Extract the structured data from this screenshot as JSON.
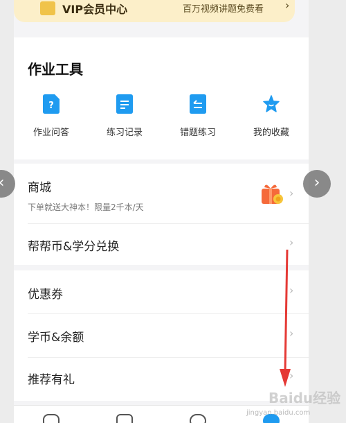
{
  "vip": {
    "title": "VIP会员中心",
    "subtitle": "百万视频讲题免费看",
    "arrow": "›"
  },
  "tools": {
    "title": "作业工具",
    "items": [
      {
        "label": "作业问答",
        "icon": "question-doc-icon"
      },
      {
        "label": "练习记录",
        "icon": "record-doc-icon"
      },
      {
        "label": "错题练习",
        "icon": "mistake-doc-icon"
      },
      {
        "label": "我的收藏",
        "icon": "star-icon"
      }
    ]
  },
  "mall": {
    "title": "商城",
    "subtitle": "下单就送大神本！限量2千本/天",
    "icon": "gift-box-icon"
  },
  "menu": {
    "exchange": "帮帮币&学分兑换",
    "coupons": "优惠券",
    "balance": "学币&余额",
    "referral": "推荐有礼"
  },
  "chevron": "›",
  "carousel": {
    "prev": "‹",
    "next": "›"
  },
  "watermark": {
    "text": "Baidu经验",
    "url": "jingyan.baidu.com"
  },
  "colors": {
    "accent": "#1f9bf0",
    "annotation_arrow": "#e53935",
    "vip_bg": "#fcefc9",
    "gift": "#f56a3a"
  }
}
